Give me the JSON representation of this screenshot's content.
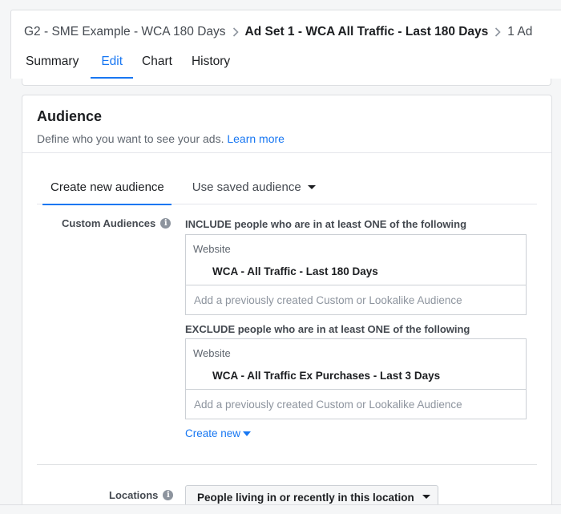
{
  "breadcrumb": {
    "campaign": "G2 - SME Example - WCA 180 Days",
    "ad_set": "Ad Set 1 - WCA All Traffic - Last 180 Days",
    "ad": "1 Ad"
  },
  "tabs": [
    {
      "label": "Summary"
    },
    {
      "label": "Edit"
    },
    {
      "label": "Chart"
    },
    {
      "label": "History"
    }
  ],
  "active_tab": "Edit",
  "audience": {
    "title": "Audience",
    "description": "Define who you want to see your ads.",
    "learn_more": "Learn more",
    "tabs": [
      {
        "label": "Create new audience"
      },
      {
        "label": "Use saved audience"
      }
    ],
    "custom_audiences_label": "Custom Audiences",
    "include": {
      "heading": "INCLUDE people who are in at least ONE of the following",
      "category": "Website",
      "item": "WCA - All Traffic - Last 180 Days",
      "placeholder": "Add a previously created Custom or Lookalike Audience"
    },
    "exclude": {
      "heading": "EXCLUDE people who are in at least ONE of the following",
      "category": "Website",
      "item": "WCA - All Traffic Ex Purchases - Last 3 Days",
      "placeholder": "Add a previously created Custom or Lookalike Audience"
    },
    "create_new": "Create new",
    "locations_label": "Locations",
    "locations_value": "People living in or recently in this location"
  },
  "colors": {
    "accent": "#1877f2",
    "text": "#1c1e21",
    "muted": "#606770",
    "border": "#ccd0d5"
  }
}
